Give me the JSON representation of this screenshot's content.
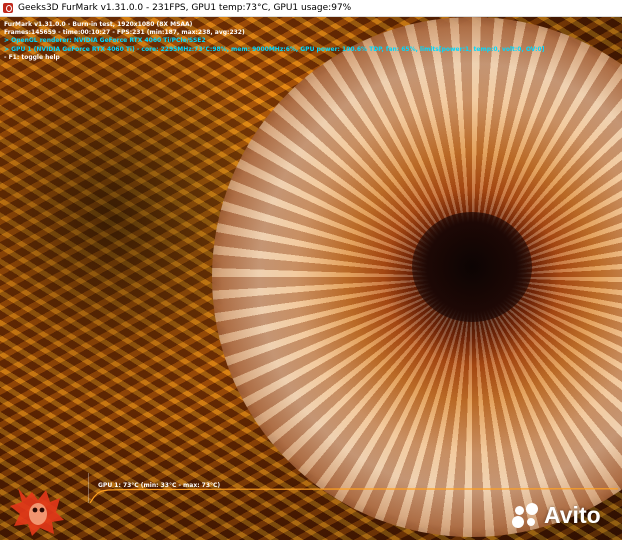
{
  "window": {
    "title": "Geeks3D FurMark v1.31.0.0 - 231FPS, GPU1 temp:73°C, GPU1 usage:97%"
  },
  "overlay": {
    "lines": [
      "FurMark v1.31.0.0 - Burn-in test, 1920x1080 (8X MSAA)",
      "Frames:145659 - time:00:10:27 - FPS:231 (min:187, max:238, avg:232)",
      "> OpenGL renderer: NVIDIA GeForce RTX 4060 Ti/PCIe/SSE2",
      "> GPU 1 (NVIDIA GeForce RTX 4060 Ti) - core: 2295MHz:73°C:98%, mem: 9000MHz:6%, GPU power: 100.6% TDP, fan: 65%, limits[power:1, temp:0, volt:0, OV:0]",
      "- F1: toggle help"
    ],
    "line_colors": [
      "#ffffff",
      "#ffffff",
      "#00d9ff",
      "#00d9ff",
      "#ffffff"
    ]
  },
  "temp_graph": {
    "label": "GPU 1: 73°C (min: 33°C - max: 73°C)",
    "line_color": "#ffa020"
  },
  "watermark": {
    "brand": "Avito"
  },
  "colors": {
    "accent_orange": "#f08a12",
    "title_bar_bg": "#ffffff",
    "overlay_cyan": "#00d9ff"
  }
}
